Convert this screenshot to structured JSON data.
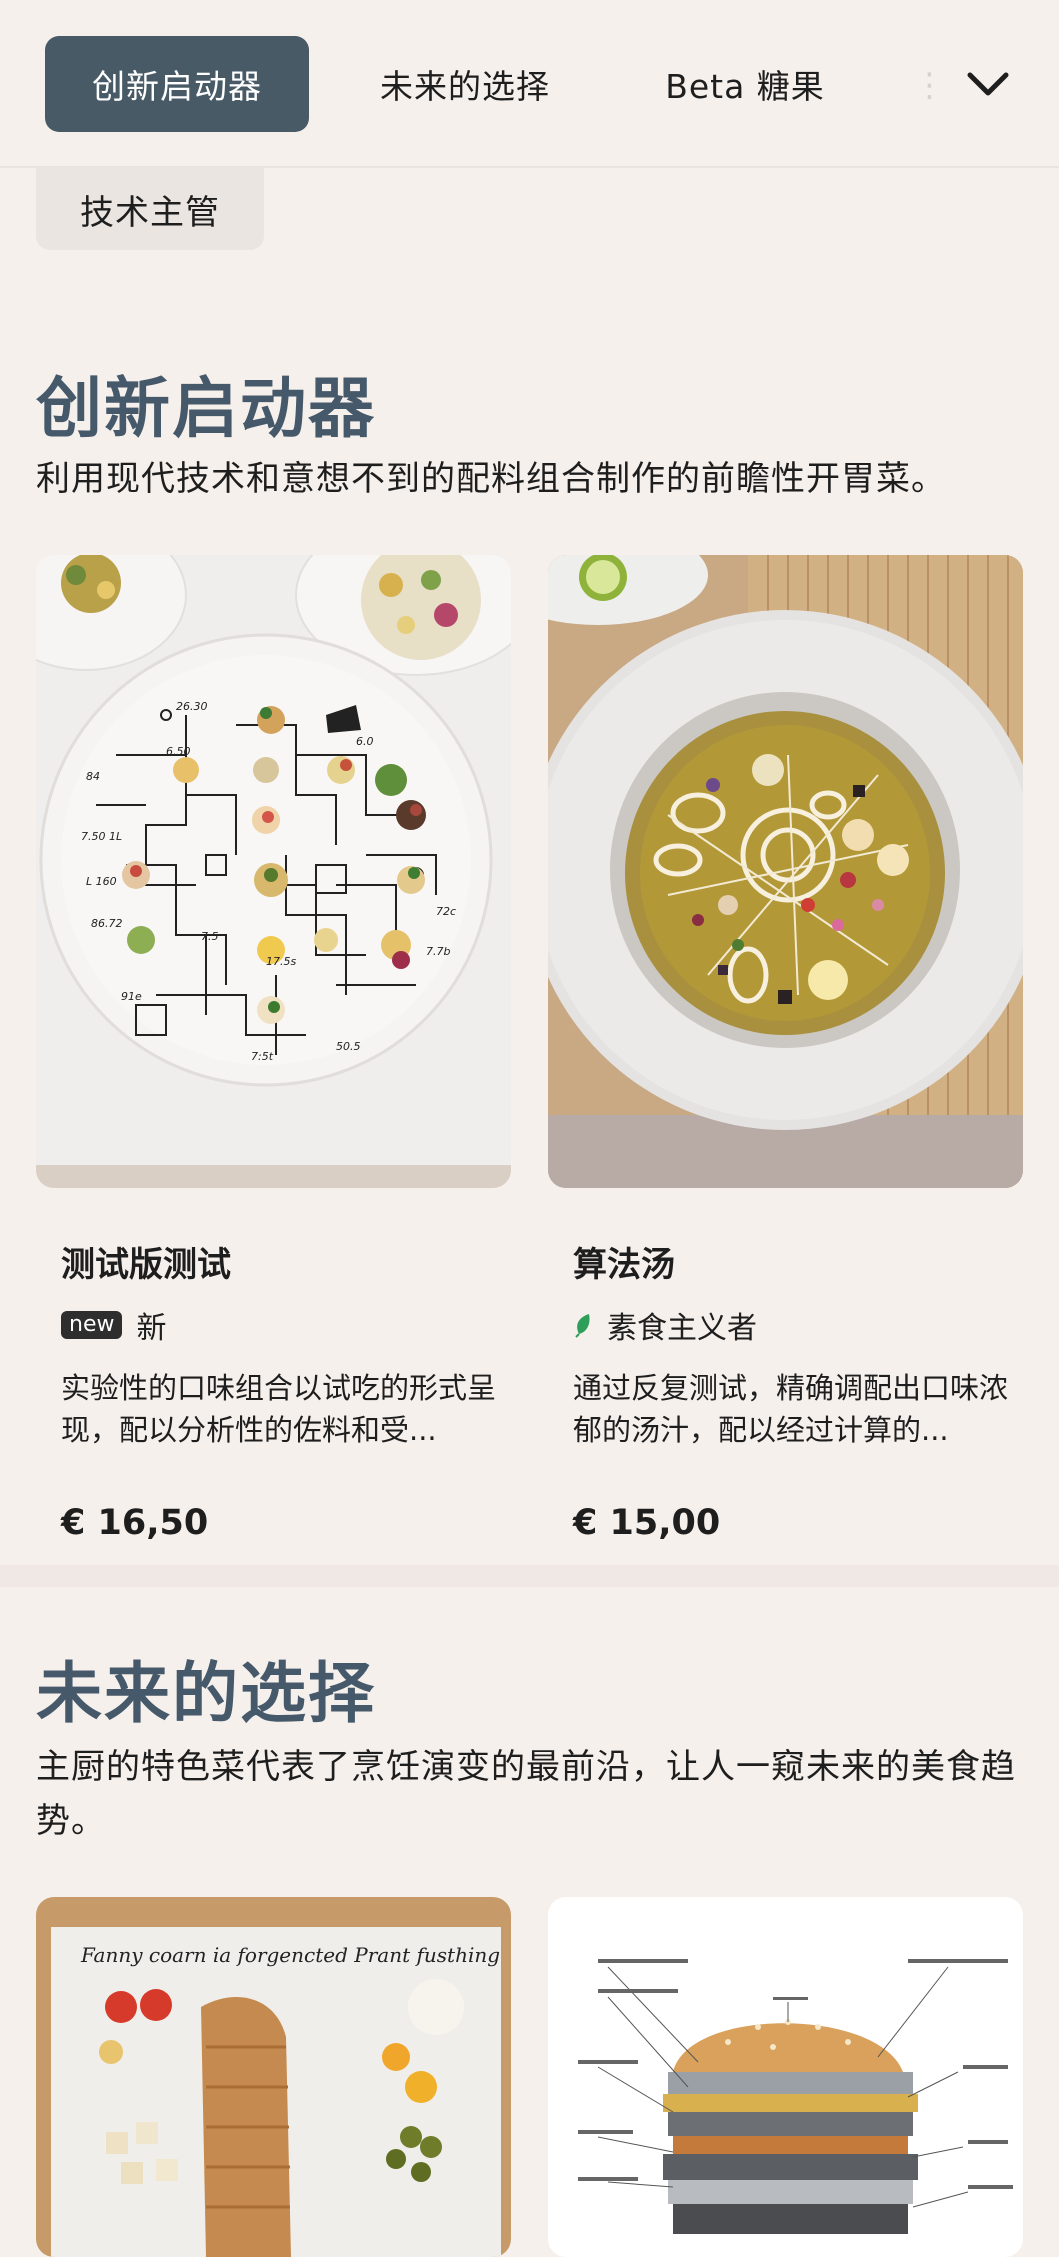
{
  "tabs": [
    {
      "label": "创新启动器",
      "active": true
    },
    {
      "label": "未来的选择",
      "active": false
    },
    {
      "label": "Beta 糖果",
      "active": false
    },
    {
      "label": "⋮",
      "active": false
    }
  ],
  "chip": {
    "label": "技术主管"
  },
  "sections": [
    {
      "title": "创新启动器",
      "description": "利用现代技术和意想不到的配料组合制作的前瞻性开胃菜。",
      "items": [
        {
          "name": "测试版测试",
          "badge": "new",
          "tag": "新",
          "description": "实验性的口味组合以试吃的形式呈现，配以分析性的佐料和受...",
          "price": "€ 16,50"
        },
        {
          "name": "算法汤",
          "badge": "",
          "tag": "素食主义者",
          "tag_icon": "leaf-icon",
          "description": "通过反复测试，精确调配出口味浓郁的汤汁，配以经过计算的...",
          "price": "€ 15,00"
        }
      ]
    },
    {
      "title": "未来的选择",
      "description": "主厨的特色菜代表了烹饪演变的最前沿，让人一窥未来的美食趋势。",
      "items": [
        {
          "image_caption": "Fanny coarn ia forgencted Prant fusthing"
        },
        {
          "image_caption": ""
        }
      ]
    }
  ],
  "colors": {
    "background": "#f6f0ec",
    "accent": "#475a66",
    "title": "#46596a",
    "leaf": "#2e9e5b"
  }
}
